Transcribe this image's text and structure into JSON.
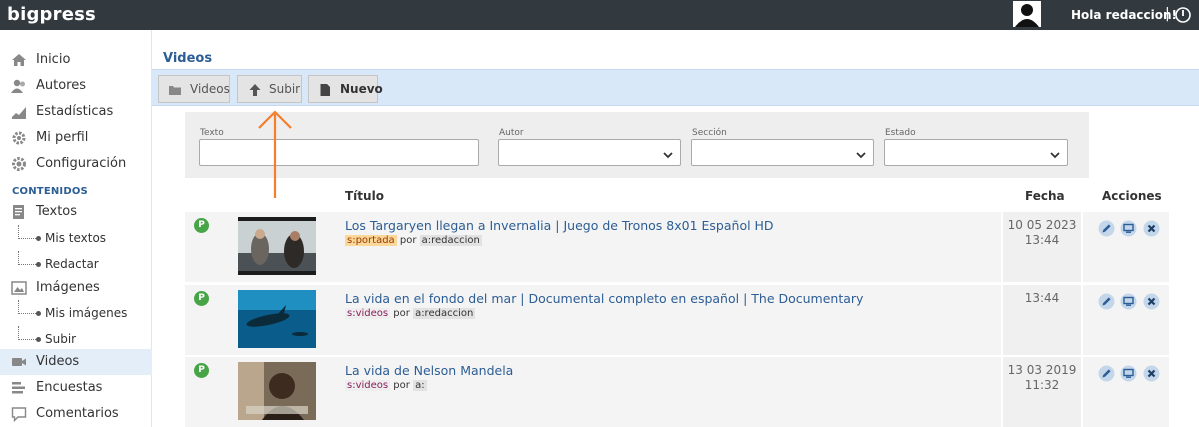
{
  "app": {
    "brand": "bigpress"
  },
  "topbar": {
    "greeting": "Hola redaccion!",
    "separator": "|"
  },
  "sidebar": {
    "items": [
      {
        "label": "Inicio",
        "icon": "home-icon"
      },
      {
        "label": "Autores",
        "icon": "users-icon"
      },
      {
        "label": "Estadísticas",
        "icon": "stats-icon"
      },
      {
        "label": "Mi perfil",
        "icon": "profile-gear-icon"
      },
      {
        "label": "Configuración",
        "icon": "gear-icon"
      }
    ],
    "section_label": "CONTENIDOS",
    "textos": {
      "label": "Textos",
      "sub": [
        "Mis textos",
        "Redactar"
      ]
    },
    "imagenes": {
      "label": "Imágenes",
      "sub": [
        "Mis imágenes",
        "Subir"
      ]
    },
    "bottom": [
      {
        "label": "Videos",
        "icon": "video-camera-icon",
        "active": true
      },
      {
        "label": "Encuestas",
        "icon": "poll-icon"
      },
      {
        "label": "Comentarios",
        "icon": "comment-icon"
      }
    ]
  },
  "page": {
    "title": "Videos"
  },
  "toolbar": {
    "videos_label": "Videos",
    "subir_label": "Subir",
    "nuevo_label": "Nuevo"
  },
  "filters": {
    "texto_label": "Texto",
    "texto_value": "",
    "autor_label": "Autor",
    "autor_value": "",
    "seccion_label": "Sección",
    "seccion_value": "",
    "estado_label": "Estado",
    "estado_value": ""
  },
  "table": {
    "headers": {
      "titulo": "Título",
      "fecha": "Fecha",
      "acciones": "Acciones"
    },
    "rows": [
      {
        "status": "P",
        "title": "Los Targaryen llegan a Invernalia | Juego de Tronos 8x01 Español HD",
        "section": "s:portada",
        "por": "por",
        "author": "a:redaccion",
        "date": "10 05 2023",
        "time": "13:44"
      },
      {
        "status": "P",
        "title": "La vida en el fondo del mar | Documental completo en español | The Documentary",
        "section": "s:videos",
        "por": "por",
        "author": "a:redaccion",
        "date": "",
        "time": "13:44"
      },
      {
        "status": "P",
        "title": "La vida de Nelson Mandela",
        "section": "s:videos",
        "por": "por",
        "author": "a:",
        "date": "13 03 2019",
        "time": "11:32"
      }
    ]
  },
  "colors": {
    "topbar": "#333a3f",
    "accent": "#2c5d94",
    "toolbar": "#d9e8f9",
    "status": "#47a447",
    "annotation_arrow": "#f47f2a"
  }
}
